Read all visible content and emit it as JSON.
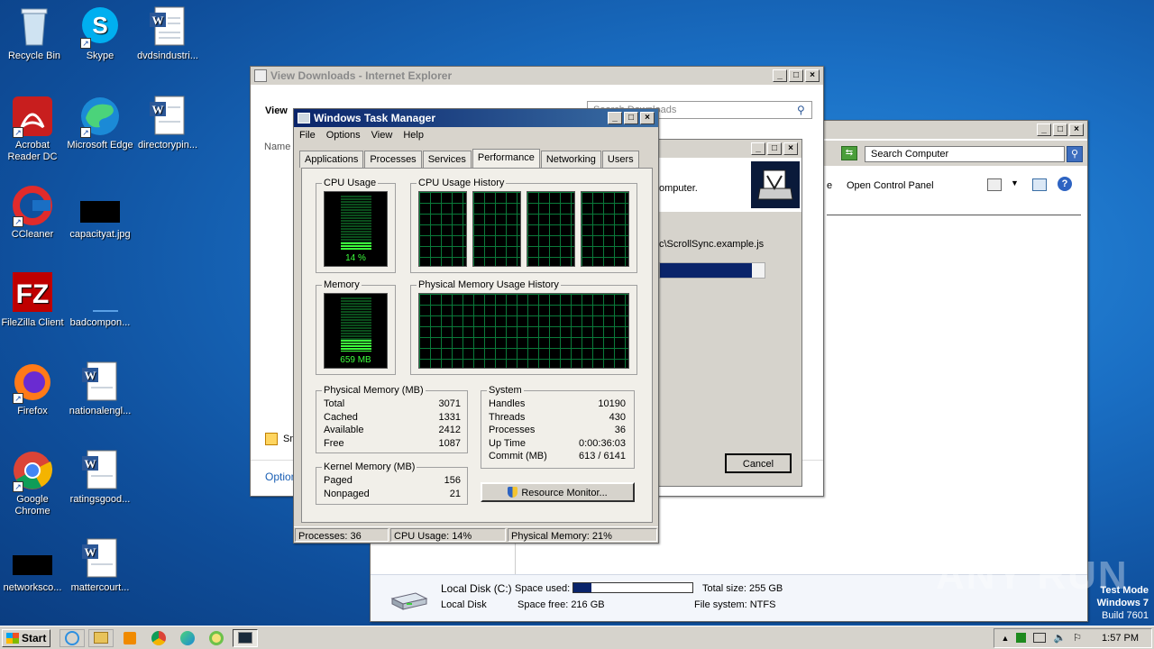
{
  "desktop": {
    "icons": [
      {
        "label": "Recycle Bin"
      },
      {
        "label": "Skype"
      },
      {
        "label": "dvdsindustri..."
      },
      {
        "label": "Acrobat Reader DC"
      },
      {
        "label": "Microsoft Edge"
      },
      {
        "label": "directorypin..."
      },
      {
        "label": "CCleaner"
      },
      {
        "label": "capacityat.jpg"
      },
      {
        "label": "FileZilla Client"
      },
      {
        "label": "badcompon..."
      },
      {
        "label": "Firefox"
      },
      {
        "label": "nationalengl..."
      },
      {
        "label": "Google Chrome"
      },
      {
        "label": "ratingsgood..."
      },
      {
        "label": "networksco..."
      },
      {
        "label": "mattercourt..."
      }
    ],
    "watermark": {
      "line1": "Test Mode",
      "line2": "Windows 7",
      "line3": "Build 7601"
    },
    "anyrun": "ANY RUN"
  },
  "ie": {
    "title": "View Downloads - Internet Explorer",
    "view_label": "View",
    "search_placeholder": "Search Downloads",
    "name_col": "Name",
    "sr_label": "Sm",
    "options_label": "Options"
  },
  "explorer": {
    "search_placeholder": "Search Computer",
    "open_cp": "Open Control Panel",
    "prev_e": "e",
    "disk_name": "Local Disk (C:)",
    "disk_type": "Local Disk",
    "space_used_label": "Space used:",
    "space_free": "Space free: 216 GB",
    "total_size": "Total size: 255 GB",
    "file_system": "File system: NTFS",
    "used_fraction": 0.15
  },
  "download_dialog": {
    "text1": "omputer.",
    "path": "c\\ScrollSync.example.js",
    "cancel": "Cancel",
    "progress": 0.88
  },
  "taskmgr": {
    "title": "Windows Task Manager",
    "menu": [
      "File",
      "Options",
      "View",
      "Help"
    ],
    "tabs": [
      "Applications",
      "Processes",
      "Services",
      "Performance",
      "Networking",
      "Users"
    ],
    "cpu_usage_title": "CPU Usage",
    "cpu_value": "14 %",
    "cpu_history_title": "CPU Usage History",
    "memory_title": "Memory",
    "memory_value": "659 MB",
    "phys_history_title": "Physical Memory Usage History",
    "physical": {
      "title": "Physical Memory (MB)",
      "rows": [
        {
          "k": "Total",
          "v": "3071"
        },
        {
          "k": "Cached",
          "v": "1331"
        },
        {
          "k": "Available",
          "v": "2412"
        },
        {
          "k": "Free",
          "v": "1087"
        }
      ]
    },
    "kernel": {
      "title": "Kernel Memory (MB)",
      "rows": [
        {
          "k": "Paged",
          "v": "156"
        },
        {
          "k": "Nonpaged",
          "v": "21"
        }
      ]
    },
    "system": {
      "title": "System",
      "rows": [
        {
          "k": "Handles",
          "v": "10190"
        },
        {
          "k": "Threads",
          "v": "430"
        },
        {
          "k": "Processes",
          "v": "36"
        },
        {
          "k": "Up Time",
          "v": "0:00:36:03"
        },
        {
          "k": "Commit (MB)",
          "v": "613 / 6141"
        }
      ]
    },
    "resource_monitor": "Resource Monitor...",
    "status": {
      "processes": "Processes: 36",
      "cpu": "CPU Usage: 14%",
      "memory": "Physical Memory: 21%"
    },
    "cpu_fraction": 0.14,
    "mem_fraction": 0.21
  },
  "taskbar": {
    "start": "Start",
    "clock": "1:57 PM"
  }
}
